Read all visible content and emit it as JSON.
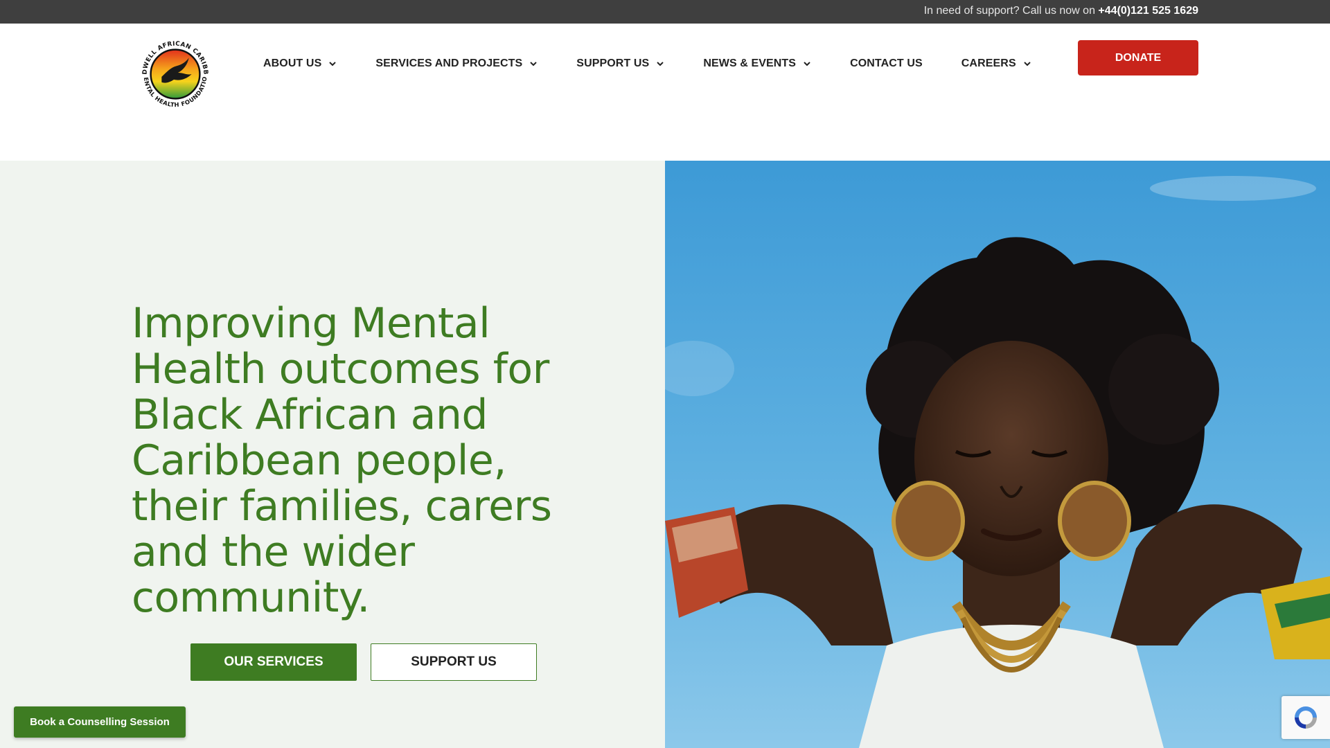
{
  "topbar": {
    "support_text": "In need of support? Call us now on ",
    "phone": "+44(0)121 525 1629",
    "background": "#3f3f3f"
  },
  "logo": {
    "name": "Sandwell African Caribbean Mental Health Foundation",
    "text_top": "SANDWELL AFRICAN CARIBBEAN",
    "text_bottom": "MENTAL HEALTH FOUNDATION"
  },
  "nav": {
    "items": [
      {
        "label": "ABOUT US",
        "has_dropdown": true
      },
      {
        "label": "SERVICES AND PROJECTS",
        "has_dropdown": true
      },
      {
        "label": "SUPPORT US",
        "has_dropdown": true
      },
      {
        "label": "NEWS & EVENTS",
        "has_dropdown": true
      },
      {
        "label": "CONTACT US",
        "has_dropdown": false
      },
      {
        "label": "CAREERS",
        "has_dropdown": true
      }
    ],
    "donate_label": "DONATE"
  },
  "hero": {
    "title": "Improving Mental Health outcomes for Black African and Caribbean people, their families, carers and the wider community.",
    "primary_button": "OUR SERVICES",
    "secondary_button": "SUPPORT US",
    "image_icon": "woman-portrait-photo"
  },
  "floating": {
    "book_label": "Book a Counselling Session",
    "recaptcha_icon": "recaptcha-icon"
  },
  "colors": {
    "brand_green": "#3e7c22",
    "donate_red": "#c8241b",
    "hero_bg": "#f0f4ef",
    "sky_blue": "#4fa6d8"
  }
}
